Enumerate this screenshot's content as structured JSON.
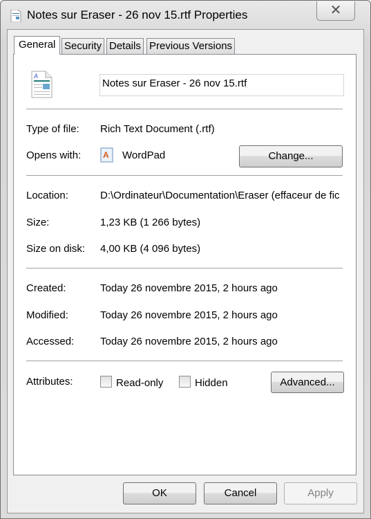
{
  "window": {
    "title": "Notes sur Eraser - 26 nov 15.rtf Properties",
    "close": "✕"
  },
  "tabs": [
    {
      "label": "General"
    },
    {
      "label": "Security"
    },
    {
      "label": "Details"
    },
    {
      "label": "Previous Versions"
    }
  ],
  "general": {
    "file_name": "Notes sur Eraser - 26 nov 15.rtf",
    "type_label": "Type of file:",
    "type_value": "Rich Text Document (.rtf)",
    "opens_label": "Opens with:",
    "opens_value": "WordPad",
    "change_label": "Change...",
    "location_label": "Location:",
    "location_value": "D:\\Ordinateur\\Documentation\\Eraser (effaceur de fic",
    "size_label": "Size:",
    "size_value": "1,23 KB (1 266 bytes)",
    "disk_label": "Size on disk:",
    "disk_value": "4,00 KB (4 096 bytes)",
    "created_label": "Created:",
    "created_value": "Today 26 novembre 2015, 2 hours ago",
    "modified_label": "Modified:",
    "modified_value": "Today 26 novembre 2015, 2 hours ago",
    "accessed_label": "Accessed:",
    "accessed_value": "Today 26 novembre 2015, 2 hours ago",
    "attributes_label": "Attributes:",
    "readonly_label": "Read-only",
    "readonly_checked": false,
    "hidden_label": "Hidden",
    "hidden_checked": false,
    "advanced_label": "Advanced..."
  },
  "buttons": {
    "ok": "OK",
    "cancel": "Cancel",
    "apply": "Apply"
  }
}
